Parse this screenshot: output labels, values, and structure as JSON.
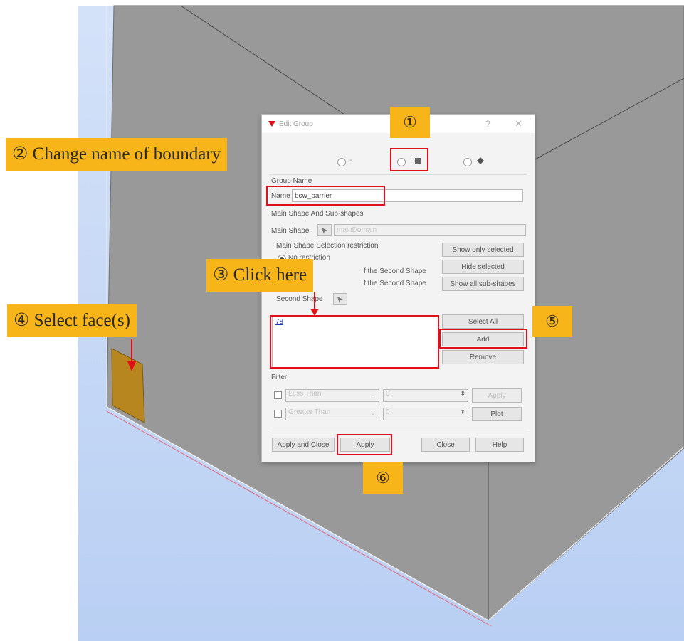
{
  "dialog": {
    "title": "Edit Group",
    "titlebar_help": "?",
    "titlebar_close": "✕",
    "shape_type_1_label": "-",
    "group_name_header": "Group Name",
    "name_label": "Name",
    "name_value": "bcw_barrier",
    "main_shape_header": "Main Shape And Sub-shapes",
    "main_shape_label": "Main Shape",
    "main_shape_value": "mainDomain",
    "restriction_header": "Main Shape Selection restriction",
    "restriction_option_1": "No restriction",
    "restriction_option_2_tail": "f the Second Shape",
    "restriction_option_3_tail": "f the Second Shape",
    "second_shape_label": "Second Shape",
    "show_only_selected": "Show only selected",
    "hide_selected": "Hide selected",
    "show_all_sub_shapes": "Show all sub-shapes",
    "list_items": [
      "78"
    ],
    "select_all": "Select All",
    "add": "Add",
    "remove": "Remove",
    "filter_header": "Filter",
    "filter_1_op": "Less Than",
    "filter_1_value": "0",
    "filter_2_op": "Greater Than",
    "filter_2_value": "0",
    "filter_apply": "Apply",
    "plot": "Plot",
    "apply_and_close": "Apply and Close",
    "apply": "Apply",
    "close": "Close",
    "help": "Help"
  },
  "callouts": {
    "step1": "①",
    "step2": "② Change name of boundary",
    "step3": "③ Click here",
    "step4": "④ Select face(s)",
    "step5": "⑤",
    "step6": "⑥"
  },
  "colors": {
    "callout_bg": "#f7b519",
    "highlight_red": "#e0101a",
    "selected_face": "#b8861f",
    "viewport_bg": "#c7dbf9",
    "model_gray": "#999999"
  }
}
